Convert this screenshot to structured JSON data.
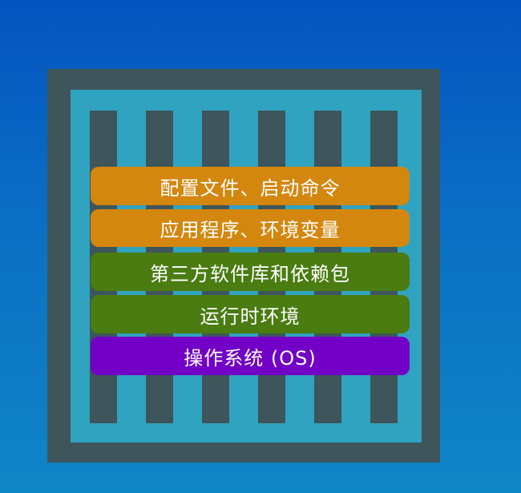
{
  "diagram": {
    "colors": {
      "frame": "#3e555b",
      "inner": "#2fa3bf",
      "config_layer": "#d4870e",
      "runtime_layer": "#4a7c12",
      "os_layer": "#7200c6"
    },
    "layers": [
      {
        "label": "配置文件、启动命令",
        "color": "#d4870e"
      },
      {
        "label": "应用程序、环境变量",
        "color": "#d4870e"
      },
      {
        "label": "第三方软件库和依赖包",
        "color": "#4a7c12"
      },
      {
        "label": "运行时环境",
        "color": "#4a7c12"
      },
      {
        "label": "操作系统 (OS)",
        "color": "#7200c6"
      }
    ]
  }
}
